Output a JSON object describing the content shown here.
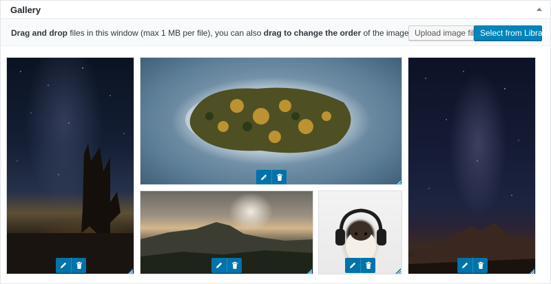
{
  "panel": {
    "title": "Gallery"
  },
  "toolbar": {
    "instructions": {
      "part1_bold": "Drag and drop",
      "part2": " files in this window (max 1 MB per file), you can also ",
      "part3_bold": "drag to change the order",
      "part4": " of the images."
    },
    "upload_label": "Upload image files",
    "library_label": "Select from Library"
  },
  "gallery": {
    "items": [
      {
        "name": "night-desert-tree",
        "icon_edit": "pencil-icon",
        "icon_delete": "trash-icon"
      },
      {
        "name": "aerial-island",
        "icon_edit": "pencil-icon",
        "icon_delete": "trash-icon"
      },
      {
        "name": "mountain-sunset",
        "icon_edit": "pencil-icon",
        "icon_delete": "trash-icon"
      },
      {
        "name": "guinea-pig-headphones",
        "icon_edit": "pencil-icon",
        "icon_delete": "trash-icon"
      },
      {
        "name": "milky-way-peak",
        "icon_edit": "pencil-icon",
        "icon_delete": "trash-icon"
      }
    ]
  },
  "colors": {
    "accent": "#0073aa",
    "primary_button": "#0085ba"
  }
}
